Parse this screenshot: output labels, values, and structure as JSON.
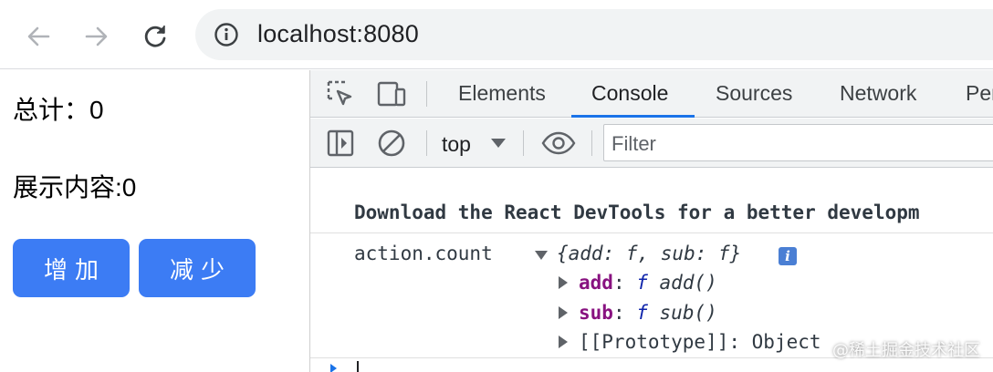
{
  "browser": {
    "url": "localhost:8080",
    "icons": [
      "back-arrow-icon",
      "forward-arrow-icon",
      "reload-icon",
      "info-icon"
    ]
  },
  "page": {
    "total_label": "总计：",
    "total_value": "0",
    "content_label": "展示内容:",
    "content_value": "0",
    "add_button": "增加",
    "sub_button": "减少"
  },
  "devtools": {
    "tabs": [
      {
        "label": "Elements",
        "active": false
      },
      {
        "label": "Console",
        "active": true
      },
      {
        "label": "Sources",
        "active": false
      },
      {
        "label": "Network",
        "active": false
      },
      {
        "label": "Per",
        "active": false
      }
    ],
    "context": "top",
    "filter_placeholder": "Filter",
    "accent_color": "#1a73e8"
  },
  "console": {
    "react_message": "Download the React DevTools for a better developm",
    "log_label": "action.count",
    "object_preview": "{add: f, sub: f}",
    "info_badge": "i",
    "props": [
      {
        "key": "add",
        "sep": ": ",
        "f": "f",
        "fn": " add()"
      },
      {
        "key": "sub",
        "sep": ": ",
        "f": "f",
        "fn": " sub()"
      }
    ],
    "prototype": "[[Prototype]]: Object"
  },
  "watermark": "@稀土掘金技术社区"
}
